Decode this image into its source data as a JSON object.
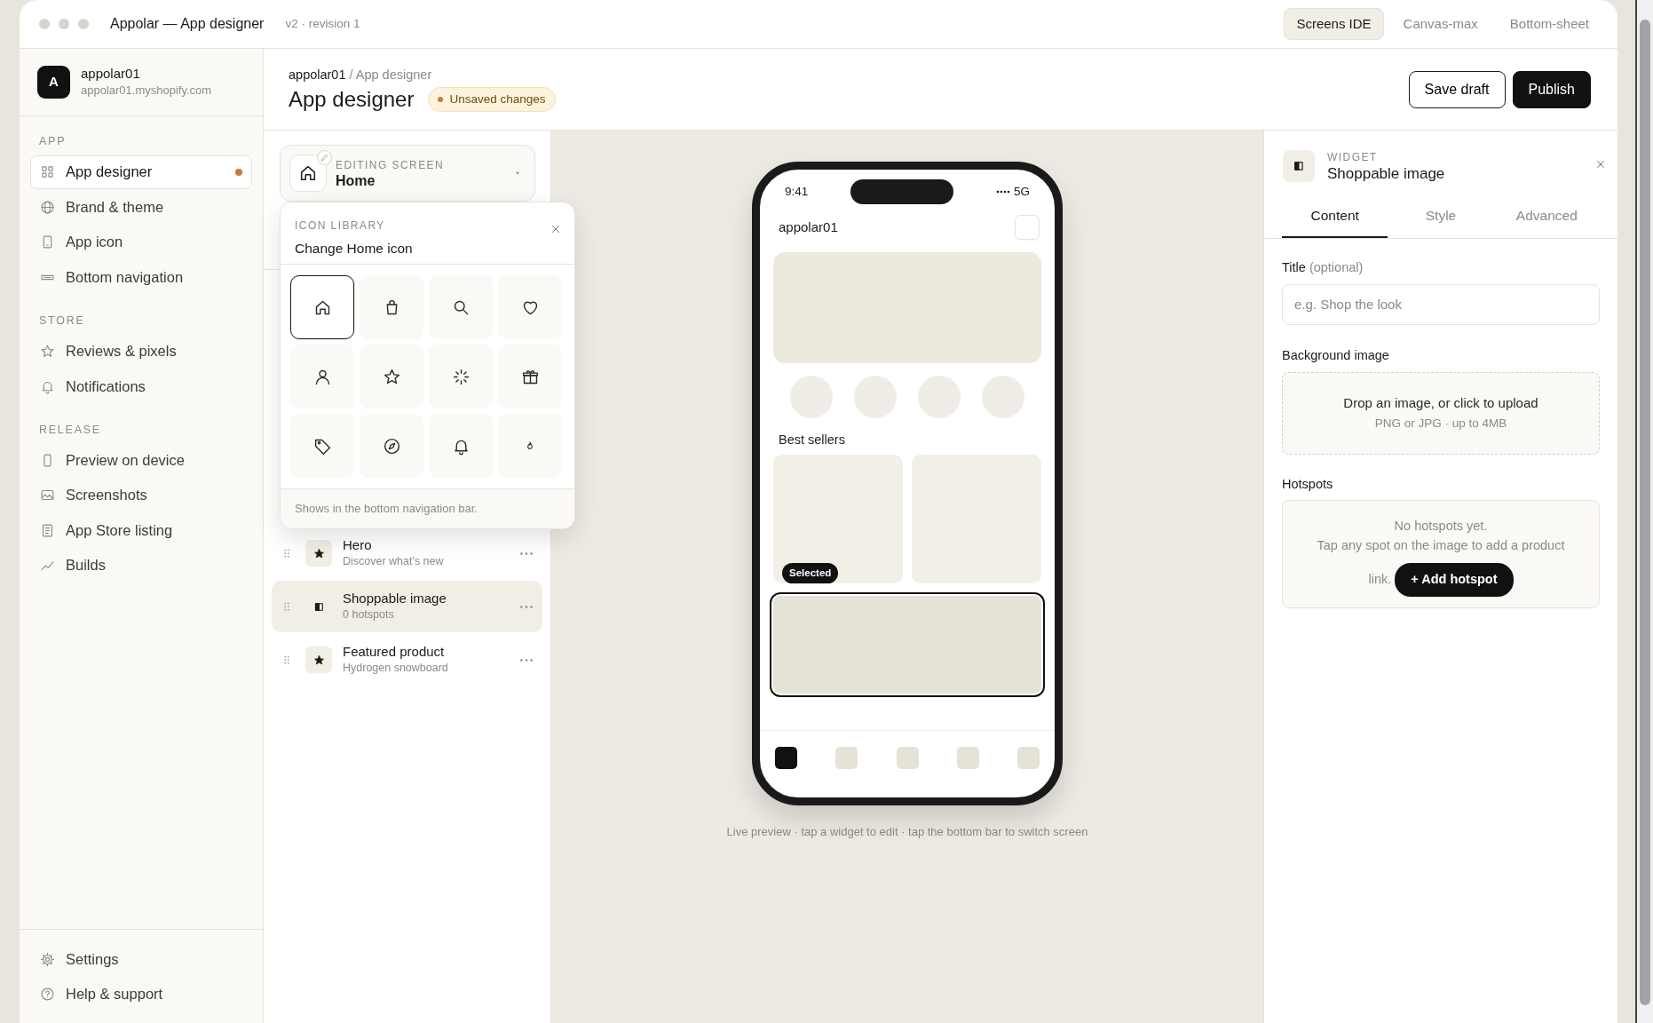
{
  "window": {
    "title": "Appolar — App designer",
    "revision": "v2 · revision 1",
    "modes": [
      {
        "label": "Screens IDE",
        "selected": true
      },
      {
        "label": "Canvas-max",
        "selected": false
      },
      {
        "label": "Bottom-sheet",
        "selected": false
      }
    ]
  },
  "sidebar": {
    "account": {
      "avatar": "A",
      "name": "appolar01",
      "domain": "appolar01.myshopify.com"
    },
    "sections": [
      {
        "heading": "APP",
        "items": [
          {
            "label": "App designer",
            "selected": true,
            "has_changes": true
          },
          {
            "label": "Brand & theme",
            "selected": false,
            "has_changes": false
          },
          {
            "label": "App icon",
            "selected": false,
            "has_changes": false
          },
          {
            "label": "Bottom navigation",
            "selected": false,
            "has_changes": false
          }
        ]
      },
      {
        "heading": "STORE",
        "items": [
          {
            "label": "Reviews & pixels",
            "selected": false,
            "has_changes": false
          },
          {
            "label": "Notifications",
            "selected": false,
            "has_changes": false
          }
        ]
      },
      {
        "heading": "RELEASE",
        "items": [
          {
            "label": "Preview on device",
            "selected": false,
            "has_changes": false
          },
          {
            "label": "Screenshots",
            "selected": false,
            "has_changes": false
          },
          {
            "label": "App Store listing",
            "selected": false,
            "has_changes": false
          },
          {
            "label": "Builds",
            "selected": false,
            "has_changes": false
          }
        ]
      }
    ],
    "footer": [
      {
        "label": "Settings"
      },
      {
        "label": "Help & support"
      }
    ]
  },
  "header": {
    "breadcrumb": "**appolar01** / App designer",
    "title": "App designer",
    "badge": "Unsaved changes",
    "buttons": [
      "Save draft",
      "Publish"
    ]
  },
  "editor": {
    "screen_picker": {
      "label": "EDITING SCREEN",
      "value": "Home"
    },
    "icon_library": {
      "heading": "ICON LIBRARY",
      "title": "Change Home icon",
      "note": "Shows in the bottom navigation bar.",
      "icons": [
        {
          "selected": true
        },
        {
          "selected": false
        },
        {
          "selected": false
        },
        {
          "selected": false
        },
        {
          "selected": false
        },
        {
          "selected": false
        },
        {
          "selected": false
        },
        {
          "selected": false
        },
        {
          "selected": false
        },
        {
          "selected": false
        },
        {
          "selected": false
        },
        {
          "selected": false
        }
      ]
    },
    "widgets": [
      {
        "title": "Hero",
        "subtitle": "Discover what's new",
        "selected": false
      },
      {
        "title": "Shoppable image",
        "subtitle": "0 hotspots",
        "selected": true
      },
      {
        "title": "Featured product",
        "subtitle": "Hydrogen snowboard",
        "selected": false
      }
    ]
  },
  "preview": {
    "time": "9:41",
    "network": "5G",
    "store": "appolar01",
    "section": "Best sellers",
    "badge": "Selected",
    "nav_tabs": [
      {
        "selected": true
      },
      {
        "selected": false
      },
      {
        "selected": false
      },
      {
        "selected": false
      },
      {
        "selected": false
      }
    ],
    "caption": "Live preview · tap a widget to edit · tap the bottom bar to switch screen"
  },
  "inspector": {
    "heading": "WIDGET",
    "title": "Shoppable image",
    "tabs": [
      {
        "label": "Content",
        "selected": true
      },
      {
        "label": "Style",
        "selected": false
      },
      {
        "label": "Advanced",
        "selected": false
      }
    ],
    "title_label": "**Title** (optional)",
    "title_placeholder": "e.g. Shop the look",
    "image_label": "Background image",
    "drop_title": "Drop an image, or click to upload",
    "drop_note": "PNG or JPG · up to 4MB",
    "hotspots_label": "Hotspots",
    "empty_title": "No hotspots yet.",
    "empty_text": [
      "Tap any spot on the image to add a product",
      "link."
    ],
    "add_button": "+ Add hotspot"
  }
}
